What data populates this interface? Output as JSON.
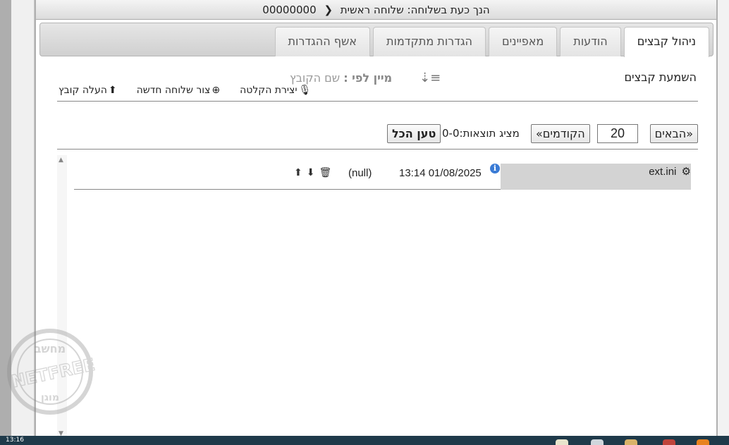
{
  "title": {
    "prefix": "הנך כעת בשלוחה:",
    "path": "שלוחה ראשית",
    "number": "00000000"
  },
  "tabs": [
    {
      "label": "ניהול קבצים",
      "active": true
    },
    {
      "label": "הודעות",
      "active": false
    },
    {
      "label": "מאפיינים",
      "active": false
    },
    {
      "label": "הגדרות מתקדמות",
      "active": false
    },
    {
      "label": "אשף ההגדרות",
      "active": false
    }
  ],
  "toolbar": {
    "section_title": "השמעת קבצים",
    "sort_label": "מיין לפי :",
    "sort_value": "שם הקובץ",
    "actions": {
      "record": "יצירת הקלטה",
      "create_extension": "צור שלוחה חדשה",
      "upload_file": "העלה קובץ"
    }
  },
  "pager": {
    "next": "«הבאים",
    "page_size": "20",
    "prev": "הקודמים»",
    "showing": "מציג תוצאות:0-0",
    "load_all": "טען הכל"
  },
  "files": [
    {
      "name": "ext.ini",
      "datetime": "13:14 01/08/2025",
      "value": "(null)"
    }
  ],
  "watermark": {
    "top": "מחשב",
    "brand": "NETFREE",
    "bottom": "מוגן"
  },
  "taskbar": {
    "clock": "13:16"
  },
  "icons": {
    "chevron": "chevron-left-icon",
    "sort": "sort-icon",
    "mic": "microphone-icon",
    "plus": "plus-circle-icon",
    "upload": "upload-icon",
    "gear": "gears-icon",
    "info": "info-icon",
    "download": "download-icon",
    "trash": "trash-icon"
  },
  "colors": {
    "info_blue": "#3a7bd5",
    "row_highlight": "#d3d3d3",
    "taskbar": "#1f3a4a"
  }
}
